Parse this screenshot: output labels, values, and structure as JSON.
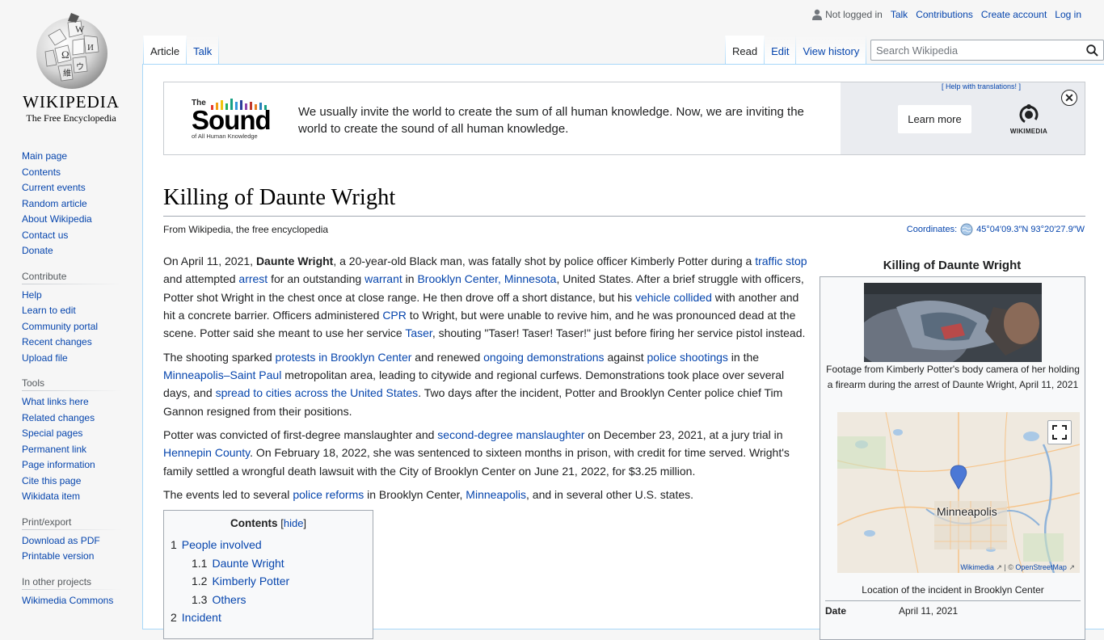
{
  "logo": {
    "wordmark": "Wikipedia",
    "tagline": "The Free Encyclopedia"
  },
  "sidebar": {
    "navigation": [
      "Main page",
      "Contents",
      "Current events",
      "Random article",
      "About Wikipedia",
      "Contact us",
      "Donate"
    ],
    "contribute": {
      "heading": "Contribute",
      "items": [
        "Help",
        "Learn to edit",
        "Community portal",
        "Recent changes",
        "Upload file"
      ]
    },
    "tools": {
      "heading": "Tools",
      "items": [
        "What links here",
        "Related changes",
        "Special pages",
        "Permanent link",
        "Page information",
        "Cite this page",
        "Wikidata item"
      ]
    },
    "print": {
      "heading": "Print/export",
      "items": [
        "Download as PDF",
        "Printable version"
      ]
    },
    "projects": {
      "heading": "In other projects",
      "items": [
        "Wikimedia Commons"
      ]
    }
  },
  "personal": {
    "status": "Not logged in",
    "talk": "Talk",
    "contributions": "Contributions",
    "create_account": "Create account",
    "login": "Log in"
  },
  "tabs": {
    "article": "Article",
    "talk": "Talk",
    "read": "Read",
    "edit": "Edit",
    "history": "View history"
  },
  "search": {
    "placeholder": "Search Wikipedia"
  },
  "banner": {
    "logo_top": "The",
    "logo_main": "Sound",
    "logo_sub": "of All Human Knowledge",
    "text": "We usually invite the world to create the sum of all human knowledge. Now, we are inviting the world to create the sound of all human knowledge.",
    "help": "[ Help with translations! ]",
    "learn_more": "Learn more",
    "wm": "WIKIMEDIA",
    "close": "✕"
  },
  "article": {
    "title": "Killing of Daunte Wright",
    "subtitle": "From Wikipedia, the free encyclopedia",
    "coords_label": "Coordinates:",
    "coords_value": "45°04′09.3″N 93°20′27.9″W",
    "p1": {
      "a": "On April 11, 2021, ",
      "b": "Daunte Wright",
      "c": ", a 20-year-old Black man, was fatally shot by police officer Kimberly Potter during a ",
      "l1": "traffic stop",
      "d": " and attempted ",
      "l2": "arrest",
      "e": " for an outstanding ",
      "l3": "warrant",
      "f": " in ",
      "l4": "Brooklyn Center, Minnesota",
      "g": ", United States. After a brief struggle with officers, Potter shot Wright in the chest once at close range. He then drove off a short distance, but his ",
      "l5": "vehicle collided",
      "h": " with another and hit a concrete barrier. Officers administered ",
      "l6": "CPR",
      "i": " to Wright, but were unable to revive him, and he was pronounced dead at the scene. Potter said she meant to use her service ",
      "l7": "Taser",
      "j": ", shouting \"Taser! Taser! Taser!\" just before firing her service pistol instead."
    },
    "p2": {
      "a": "The shooting sparked ",
      "l1": "protests in Brooklyn Center",
      "b": " and renewed ",
      "l2": "ongoing demonstrations",
      "c": " against ",
      "l3": "police shootings",
      "d": " in the ",
      "l4": "Minneapolis–Saint Paul",
      "e": " metropolitan area, leading to citywide and regional curfews. Demonstrations took place over several days, and ",
      "l5": "spread to cities across the United States",
      "f": ". Two days after the incident, Potter and Brooklyn Center police chief Tim Gannon resigned from their positions."
    },
    "p3": {
      "a": "Potter was convicted of first-degree manslaughter and ",
      "l1": "second-degree manslaughter",
      "b": " on December 23, 2021, at a jury trial in ",
      "l2": "Hennepin County",
      "c": ". On February 18, 2022, she was sentenced to sixteen months in prison, with credit for time served. Wright's family settled a wrongful death lawsuit with the City of Brooklyn Center on June 21, 2022, for $3.25 million."
    },
    "p4": {
      "a": "The events led to several ",
      "l1": "police reforms",
      "b": " in Brooklyn Center, ",
      "l2": "Minneapolis",
      "c": ", and in several other U.S. states."
    }
  },
  "toc": {
    "title": "Contents",
    "hide": "hide",
    "items": [
      {
        "num": "1",
        "label": "People involved"
      },
      {
        "num": "1.1",
        "label": "Daunte Wright"
      },
      {
        "num": "1.2",
        "label": "Kimberly Potter"
      },
      {
        "num": "1.3",
        "label": "Others"
      },
      {
        "num": "2",
        "label": "Incident"
      }
    ]
  },
  "infobox": {
    "title": "Killing of Daunte Wright",
    "caption1": "Footage from Kimberly Potter's body camera of her holding a firearm during the arrest of Daunte Wright, April 11, 2021",
    "map_label": "Minneapolis",
    "map_attr_wm": "Wikimedia",
    "map_attr_osm": "OpenStreetMap",
    "caption2": "Location of the incident in Brooklyn Center",
    "date_label": "Date",
    "date_value": "April 11, 2021"
  }
}
